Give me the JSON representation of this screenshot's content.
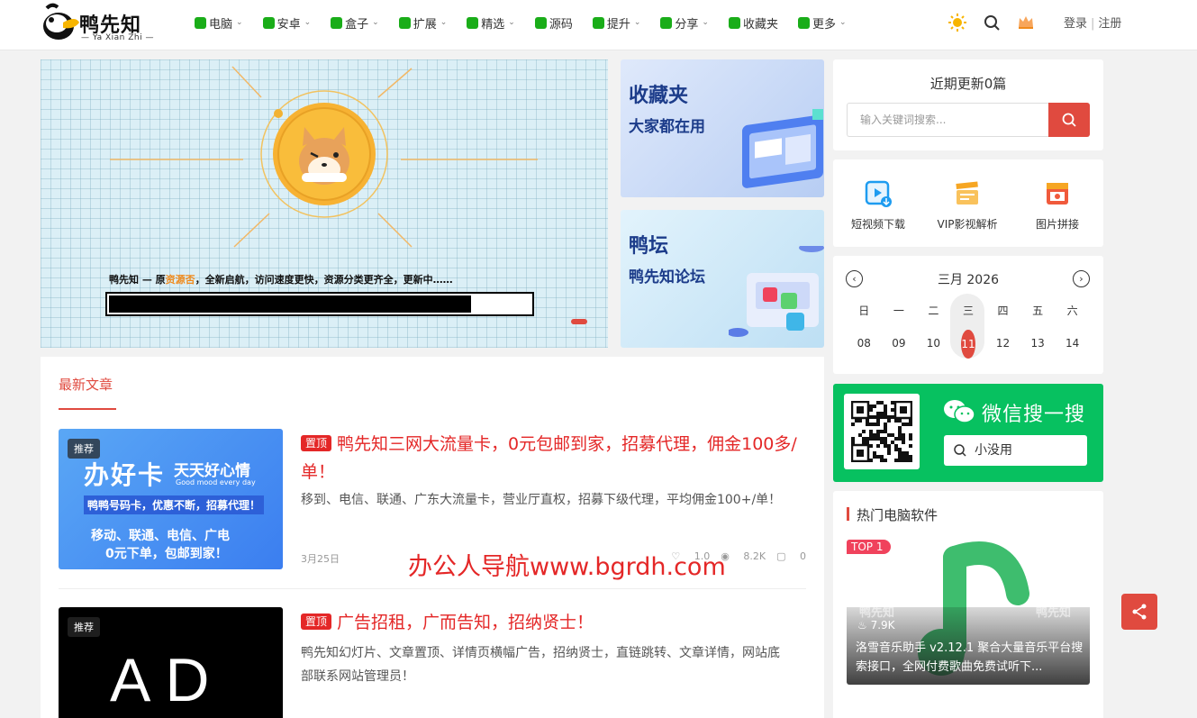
{
  "brand": {
    "name": "鸭先知",
    "tagline": "— Ya Xian Zhi —"
  },
  "nav": [
    {
      "label": "电脑",
      "icon": "windows-icon",
      "has_dropdown": true
    },
    {
      "label": "安卓",
      "icon": "android-icon",
      "has_dropdown": true
    },
    {
      "label": "盒子",
      "icon": "tv-icon",
      "has_dropdown": true
    },
    {
      "label": "扩展",
      "icon": "puzzle-icon",
      "has_dropdown": true
    },
    {
      "label": "精选",
      "icon": "star-icon",
      "has_dropdown": true
    },
    {
      "label": "源码",
      "icon": "play-icon",
      "has_dropdown": false
    },
    {
      "label": "提升",
      "icon": "rocket-icon",
      "has_dropdown": true
    },
    {
      "label": "分享",
      "icon": "send-icon",
      "has_dropdown": true
    },
    {
      "label": "收藏夹",
      "icon": "star-icon",
      "has_dropdown": false
    },
    {
      "label": "更多",
      "icon": "grid-icon",
      "has_dropdown": true
    }
  ],
  "header": {
    "login": "登录",
    "separator": "|",
    "register": "注册"
  },
  "hero": {
    "caption_pre": "鸭先知 — 原",
    "caption_highlight": "资源否",
    "caption_post": "，全新启航，访问速度更快，资源分类更齐全，更新中……",
    "progress": 0.86
  },
  "promos": [
    {
      "title": "收藏夹",
      "subtitle": "大家都在用"
    },
    {
      "title": "鸭坛",
      "subtitle": "鸭先知论坛"
    }
  ],
  "articles": {
    "tab": "最新文章",
    "items": [
      {
        "badge": "推荐",
        "pin": "置顶",
        "title": "鸭先知三网大流量卡，0元包邮到家，招募代理，佣金100多/单！",
        "excerpt": "移到、电信、联通、广东大流量卡，营业厅直权，招募下级代理，平均佣金100+/单！",
        "date": "3月25日",
        "likes": "1.0",
        "views": "8.2K",
        "comments": "0",
        "thumb_text": {
          "main": "办好卡",
          "sub": "天天好心情",
          "en": "Good mood every day",
          "line2": "鸭鸭号码卡，优惠不断，招募代理！",
          "line3": "移动、联通、电信、广电",
          "line4": "0元下单，包邮到家！"
        }
      },
      {
        "badge": "推荐",
        "pin": "置顶",
        "title": "广告招租，广而告知，招纳贤士！",
        "excerpt": "鸭先知幻灯片、文章置顶、详情页横幅广告，招纳贤士，直链跳转、文章详情，网站底部联系网站管理员！",
        "thumb_text": {
          "main": "AD"
        }
      }
    ]
  },
  "watermark": "办公人导航www.bgrdh.com",
  "sidebar": {
    "search": {
      "title": "近期更新0篇",
      "placeholder": "输入关键词搜索..."
    },
    "tools": [
      {
        "label": "短视频下载",
        "icon": "video-download-icon"
      },
      {
        "label": "VIP影视解析",
        "icon": "film-clapper-icon"
      },
      {
        "label": "图片拼接",
        "icon": "image-collage-icon"
      }
    ],
    "calendar": {
      "title": "三月 2026",
      "weekdays": [
        "日",
        "一",
        "二",
        "三",
        "四",
        "五",
        "六"
      ],
      "days": [
        "08",
        "09",
        "10",
        "11",
        "12",
        "13",
        "14"
      ],
      "today": "11"
    },
    "wechat": {
      "title": "微信搜一搜",
      "query": "小没用"
    },
    "hot": {
      "title": "热门电脑软件",
      "rank": "TOP 1",
      "watermark": "鸭先知",
      "views": "7.9K",
      "name": "洛雪音乐助手 v2.12.1 聚合大量音乐平台搜索接口，全网付费歌曲免费试听下..."
    }
  },
  "colors": {
    "accent": "#e04a3f",
    "nav_icon": "#1aad19",
    "wechat": "#07c160",
    "pin": "#e42727"
  }
}
